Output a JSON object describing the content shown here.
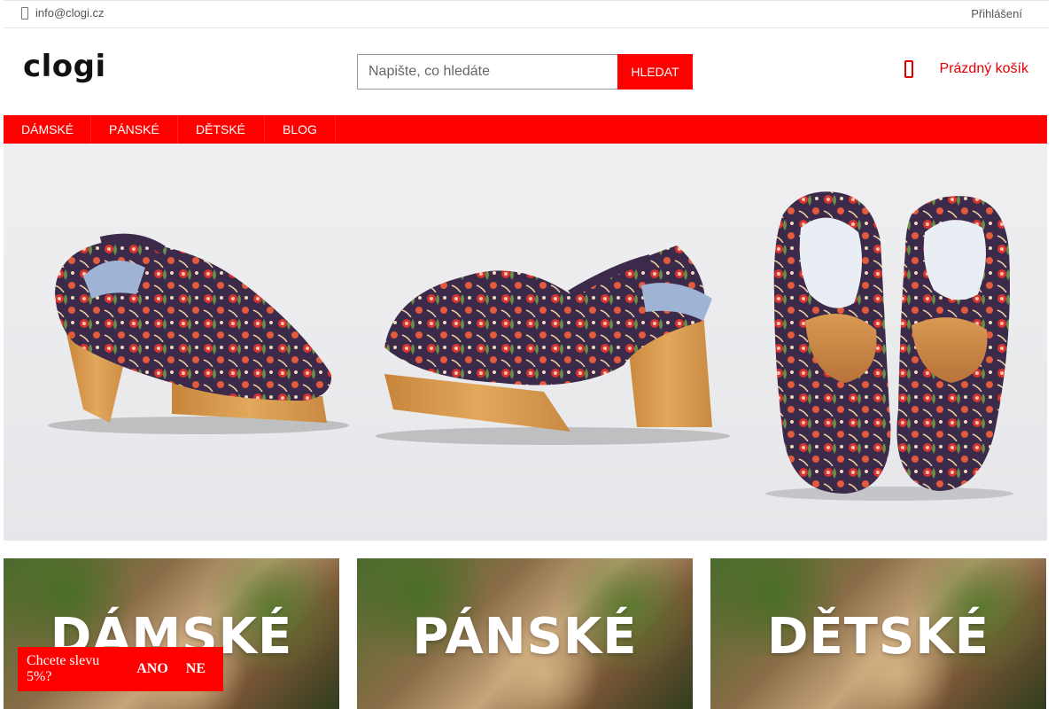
{
  "topbar": {
    "email": "info@clogi.cz",
    "login": "Přihlášení",
    "email_icon": "envelope-icon"
  },
  "header": {
    "logo": "clogi",
    "search": {
      "placeholder": "Napište, co hledáte",
      "button": "HLEDAT"
    },
    "cart": {
      "label": "Prázdný košík",
      "icon": "shopping-bag-icon"
    }
  },
  "nav": {
    "items": [
      "DÁMSKÉ",
      "PÁNSKÉ",
      "DĚTSKÉ",
      "BLOG"
    ]
  },
  "tiles": [
    {
      "title": "DÁMSKÉ"
    },
    {
      "title": "PÁNSKÉ"
    },
    {
      "title": "DĚTSKÉ"
    }
  ],
  "popup": {
    "question": "Chcete slevu 5%?",
    "yes": "ANO",
    "no": "NE"
  },
  "colors": {
    "accent": "#ff0000",
    "text": "#333333",
    "wood": "#d69a4a"
  }
}
